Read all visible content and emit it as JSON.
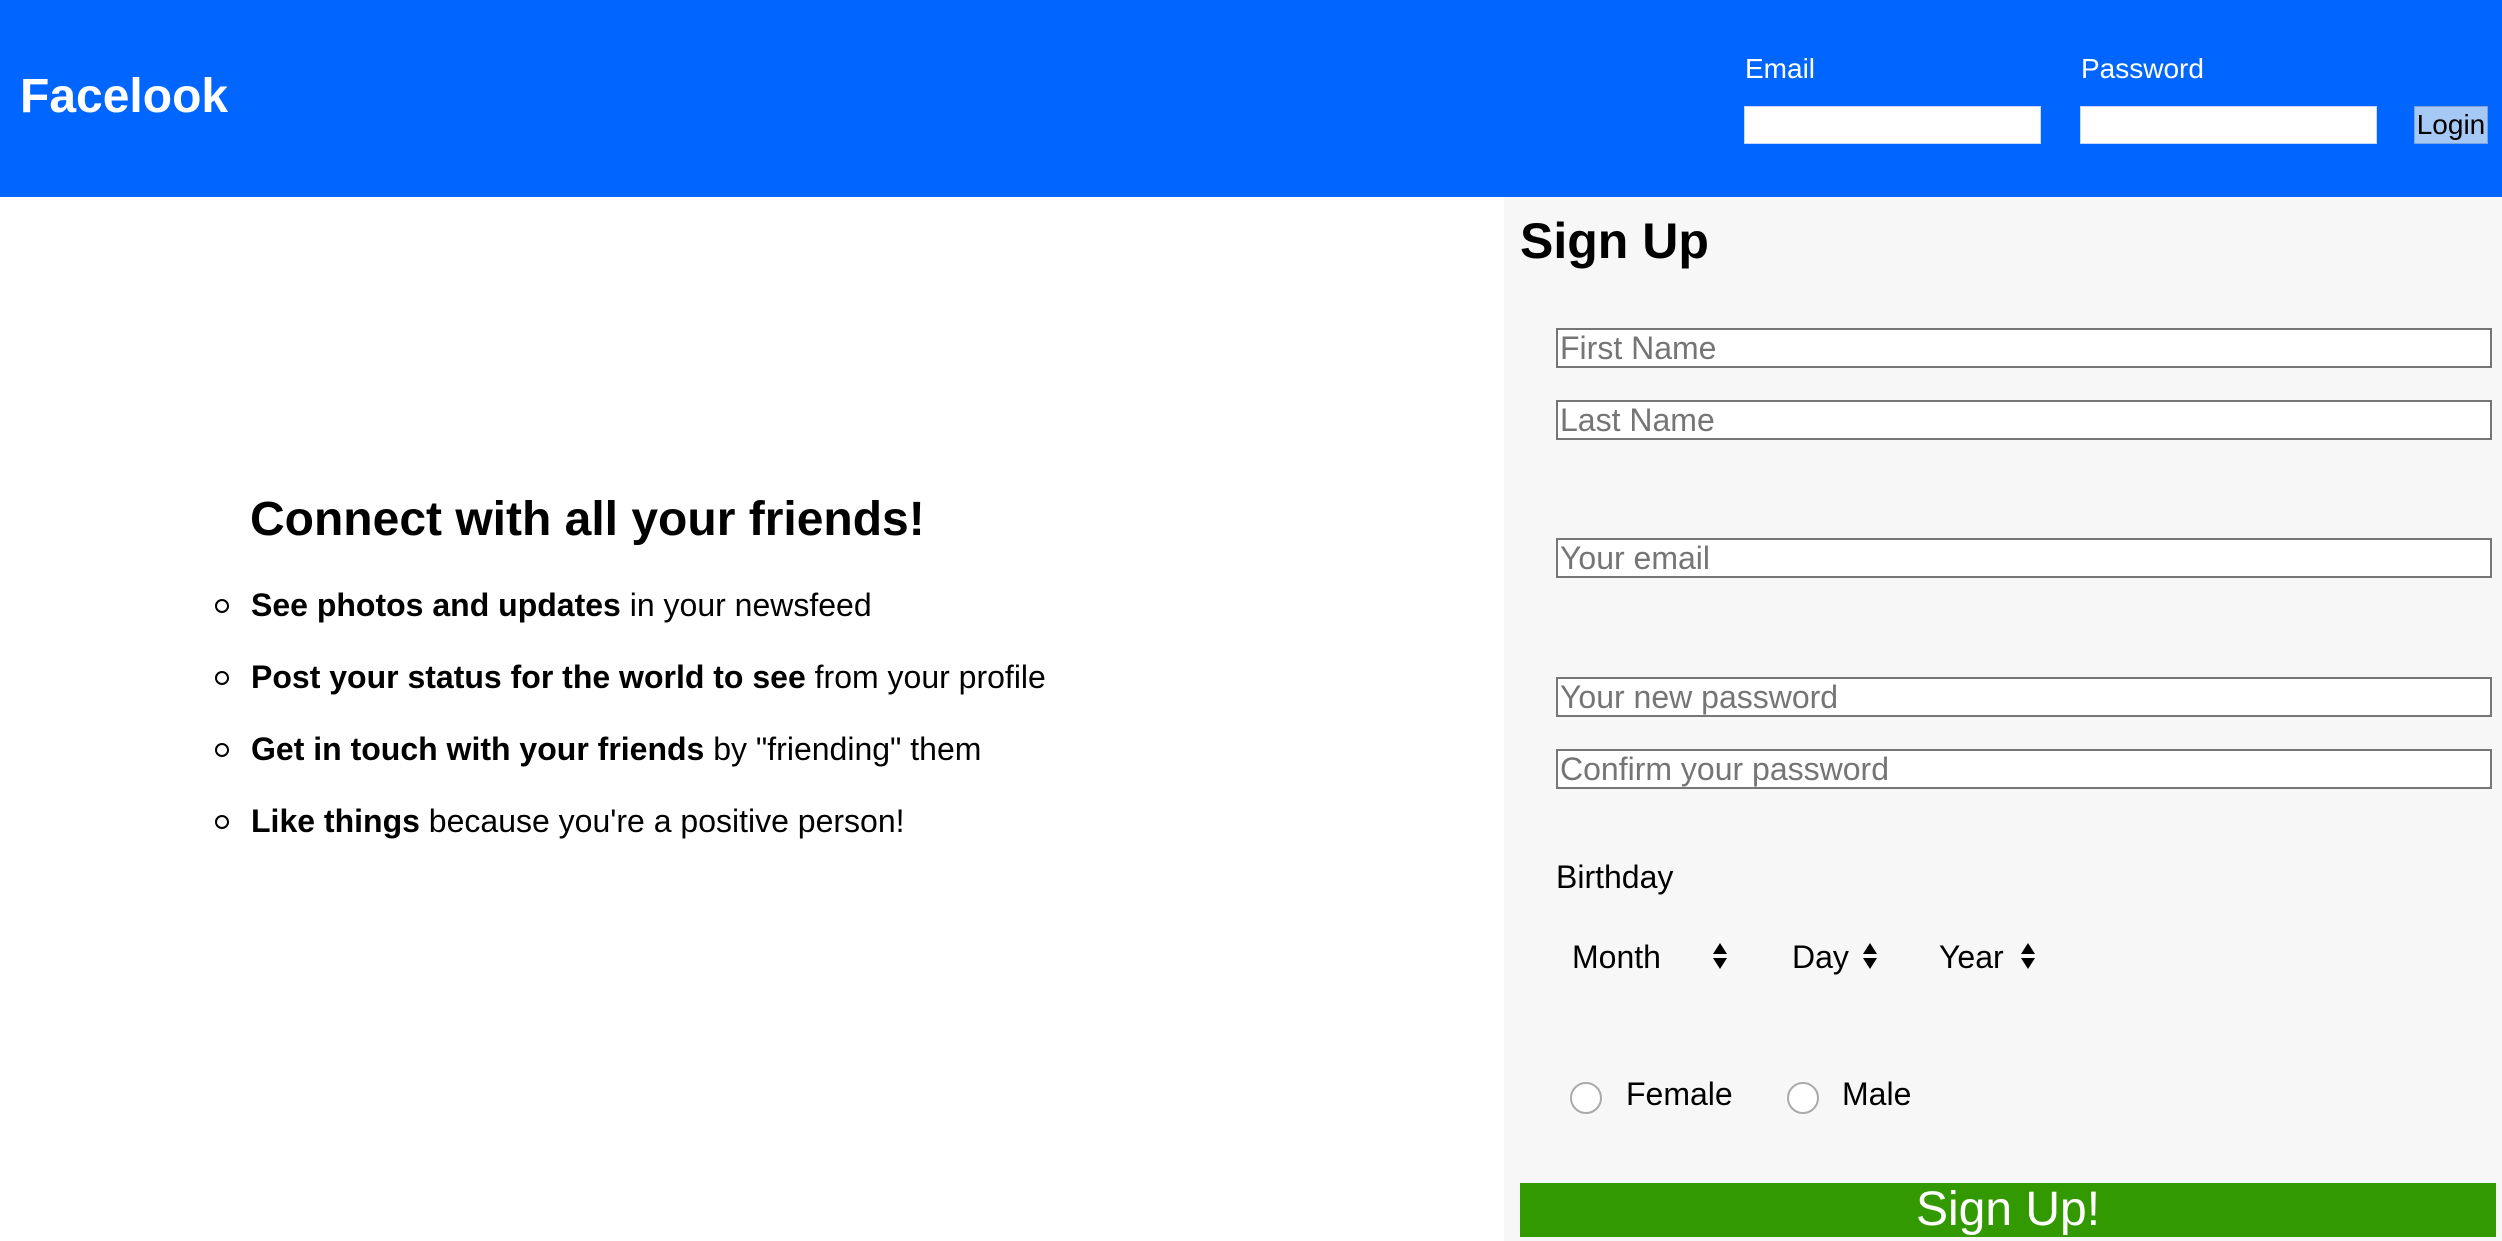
{
  "header": {
    "brand": "Facelook",
    "email_label": "Email",
    "password_label": "Password",
    "login_label": "Login"
  },
  "promo": {
    "title": "Connect with all your friends!",
    "items": [
      {
        "bold": "See photos and updates",
        "rest": " in your newsfeed"
      },
      {
        "bold": "Post your status for the world to see",
        "rest": " from your profile"
      },
      {
        "bold": "Get in touch with your friends",
        "rest": " by \"friending\" them"
      },
      {
        "bold": "Like things",
        "rest": " because you're a positive person!"
      }
    ]
  },
  "signup": {
    "title": "Sign Up",
    "first_name_placeholder": "First Name",
    "last_name_placeholder": "Last Name",
    "email_placeholder": "Your email",
    "new_password_placeholder": "Your new password",
    "confirm_password_placeholder": "Confirm your password",
    "birthday_label": "Birthday",
    "month_label": "Month",
    "day_label": "Day",
    "year_label": "Year",
    "female_label": "Female",
    "male_label": "Male",
    "submit_label": "Sign Up!"
  },
  "colors": {
    "header_bg": "#0066ff",
    "signup_button_bg": "#339900",
    "signup_panel_bg": "#f7f7f7"
  }
}
